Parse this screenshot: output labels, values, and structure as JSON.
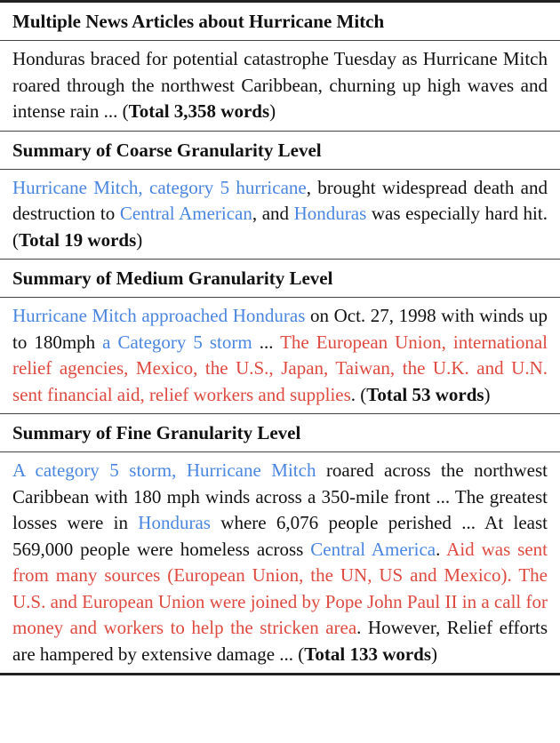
{
  "sections": [
    {
      "title": "Multiple News Articles about Hurricane Mitch",
      "segments": [
        {
          "text": "Honduras braced for potential catastrophe Tuesday as Hurri­cane Mitch roared through the northwest Caribbean, churn­ing up high waves and intense rain ... ",
          "style": "plain"
        }
      ],
      "total": "Total 3,358 words"
    },
    {
      "title": "Summary of Coarse Granularity Level",
      "segments": [
        {
          "text": "Hurricane Mitch, category 5 hurricane",
          "style": "blue"
        },
        {
          "text": ", brought widespread death and destruction to ",
          "style": "plain"
        },
        {
          "text": "Central American",
          "style": "blue"
        },
        {
          "text": ", and ",
          "style": "plain"
        },
        {
          "text": "Honduras",
          "style": "blue"
        },
        {
          "text": " was especially hard hit. ",
          "style": "plain"
        }
      ],
      "total": "Total 19 words"
    },
    {
      "title": "Summary of Medium Granularity Level",
      "segments": [
        {
          "text": "Hurricane Mitch approached Honduras",
          "style": "blue"
        },
        {
          "text": " on Oct. 27, 1998 with winds up to 180mph ",
          "style": "plain"
        },
        {
          "text": "a Category 5 storm",
          "style": "blue"
        },
        {
          "text": " ... ",
          "style": "plain"
        },
        {
          "text": "The European Union, international relief agencies, Mexico, the U.S., Japan, Taiwan, the U.K. and U.N. sent financial aid, relief workers and supplies",
          "style": "red"
        },
        {
          "text": ". ",
          "style": "plain"
        }
      ],
      "total": "Total 53 words"
    },
    {
      "title": "Summary of Fine Granularity Level",
      "segments": [
        {
          "text": "A category 5 storm, Hurricane Mitch",
          "style": "blue"
        },
        {
          "text": " roared across the north­west Caribbean with 180 mph winds across a 350-mile front ... The greatest losses were in ",
          "style": "plain"
        },
        {
          "text": "Honduras",
          "style": "blue"
        },
        {
          "text": " where 6,076 people perished ... At least 569,000 people were homeless across ",
          "style": "plain"
        },
        {
          "text": "Central America",
          "style": "blue"
        },
        {
          "text": ". ",
          "style": "plain"
        },
        {
          "text": "Aid was sent from many sources (Euro­pean Union, the UN, US and Mexico). The U.S. and European Union were joined by Pope John Paul II in a call for money and workers to help the stricken area",
          "style": "red"
        },
        {
          "text": ". However, Relief efforts are hampered by extensive damage ... ",
          "style": "plain"
        }
      ],
      "total": "Total 133 words"
    }
  ],
  "colors": {
    "entity_highlight": "#4a86e0",
    "aid_highlight": "#de4a40",
    "text": "#111111"
  }
}
